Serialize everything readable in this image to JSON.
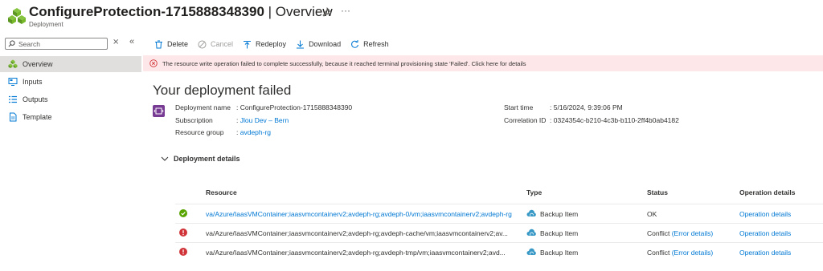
{
  "header": {
    "title": "ConfigureProtection-1715888348390",
    "separator": " | ",
    "section": "Overview",
    "subtitle": "Deployment",
    "more": "···"
  },
  "sidebar": {
    "search_placeholder": "Search",
    "items": [
      {
        "label": "Overview",
        "icon": "deployment-icon",
        "active": true
      },
      {
        "label": "Inputs",
        "icon": "inputs-icon"
      },
      {
        "label": "Outputs",
        "icon": "outputs-icon"
      },
      {
        "label": "Template",
        "icon": "template-icon"
      }
    ]
  },
  "toolbar": {
    "delete": "Delete",
    "cancel": "Cancel",
    "redeploy": "Redeploy",
    "download": "Download",
    "refresh": "Refresh"
  },
  "banner": {
    "text": "The resource write operation failed to complete successfully, because it reached terminal provisioning state 'Failed'. Click here for details"
  },
  "main": {
    "heading": "Your deployment failed",
    "left": [
      {
        "key": "Deployment name",
        "value": "ConfigureProtection-1715888348390",
        "link": false
      },
      {
        "key": "Subscription",
        "value": "Jlou Dev – Bern",
        "link": true
      },
      {
        "key": "Resource group",
        "value": "avdeph-rg",
        "link": true
      }
    ],
    "right": [
      {
        "key": "Start time",
        "value": "5/16/2024, 9:39:06 PM"
      },
      {
        "key": "Correlation ID",
        "value": "0324354c-b210-4c3b-b110-2ff4b0ab4182"
      }
    ],
    "details_label": "Deployment details"
  },
  "table": {
    "headers": [
      "Resource",
      "Type",
      "Status",
      "Operation details"
    ],
    "rows": [
      {
        "status_icon": "success-icon",
        "resource": "va/Azure/IaasVMContainer;iaasvmcontainerv2;avdeph-rg;avdeph-0/vm;iaasvmcontainerv2;avdeph-rg",
        "resource_link": true,
        "type": "Backup Item",
        "status": "OK",
        "status_link": "",
        "op": "Operation details"
      },
      {
        "status_icon": "error-icon",
        "resource": "va/Azure/IaasVMContainer;iaasvmcontainerv2;avdeph-rg;avdeph-cache/vm;iaasvmcontainerv2;av...",
        "resource_link": false,
        "type": "Backup Item",
        "status": "Conflict",
        "status_link": "(Error details)",
        "op": "Operation details"
      },
      {
        "status_icon": "error-icon",
        "resource": "va/Azure/IaasVMContainer;iaasvmcontainerv2;avdeph-rg;avdeph-tmp/vm;iaasvmcontainerv2;avd...",
        "resource_link": false,
        "type": "Backup Item",
        "status": "Conflict",
        "status_link": "(Error details)",
        "op": "Operation details"
      }
    ]
  },
  "colors": {
    "accent": "#0078d4",
    "error": "#d13438",
    "success": "#57a300",
    "banner_bg": "#fde7e9"
  }
}
